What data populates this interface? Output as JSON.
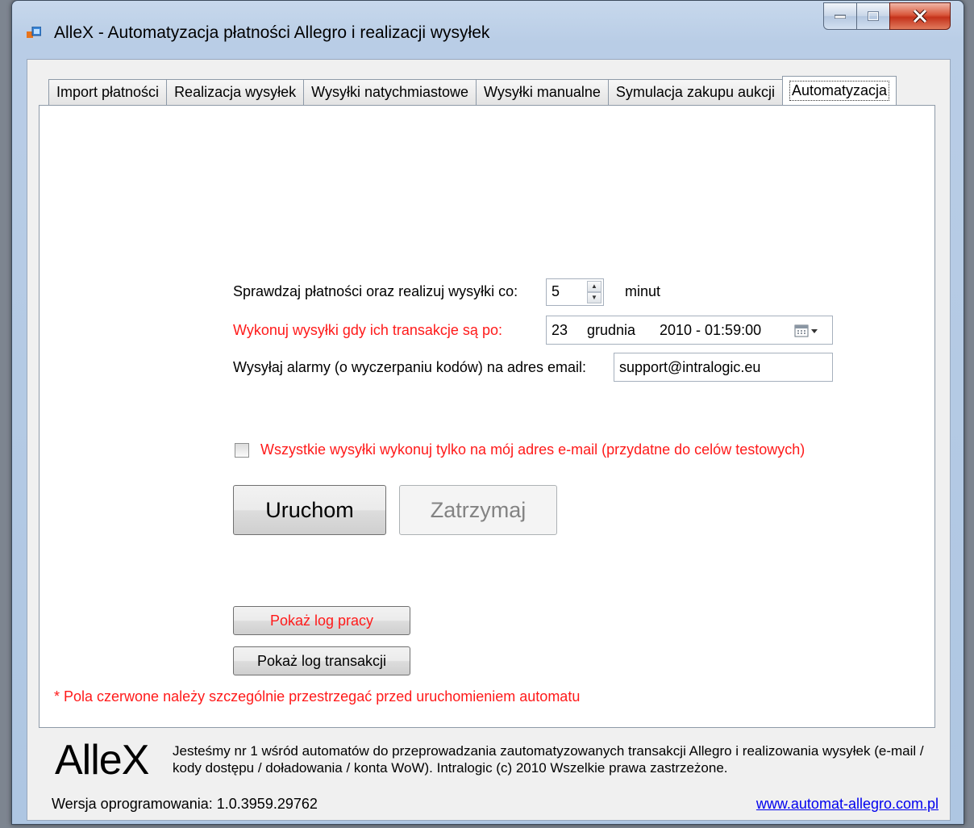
{
  "window": {
    "title": "AlleX - Automatyzacja płatności Allegro i realizacji wysyłek"
  },
  "tabs": [
    {
      "label": "Import płatności"
    },
    {
      "label": "Realizacja wysyłek"
    },
    {
      "label": "Wysyłki natychmiastowe"
    },
    {
      "label": "Wysyłki manualne"
    },
    {
      "label": "Symulacja zakupu aukcji"
    },
    {
      "label": "Automatyzacja",
      "active": true
    }
  ],
  "automation": {
    "interval_label": "Sprawdzaj płatności oraz realizuj wysyłki co:",
    "interval_value": "5",
    "interval_unit": "minut",
    "after_label": "Wykonuj wysyłki gdy ich transakcje są po:",
    "date": {
      "day": "23",
      "month": "grudnia",
      "year_time": "2010 - 01:59:00"
    },
    "email_label": "Wysyłaj alarmy (o wyczerpaniu kodów) na adres email:",
    "email_value": "support@intralogic.eu",
    "test_checkbox_label": "Wszystkie wysyłki wykonuj tylko na mój adres e-mail (przydatne do celów testowych)",
    "test_checkbox_checked": false,
    "start_button": "Uruchom",
    "stop_button": "Zatrzymaj",
    "show_work_log": "Pokaż log pracy",
    "show_transaction_log": "Pokaż log transakcji",
    "note": "* Pola czerwone należy szczególnie przestrzegać przed uruchomieniem automatu"
  },
  "footer": {
    "logo": "AlleX",
    "description": "Jesteśmy nr 1 wśród automatów do przeprowadzania zautomatyzowanych transakcji Allegro i realizowania wysyłek (e-mail / kody dostępu / doładowania / konta WoW).  Intralogic (c) 2010 Wszelkie prawa zastrzeżone.",
    "version": "Wersja oprogramowania: 1.0.3959.29762",
    "link": "www.automat-allegro.com.pl"
  },
  "colors": {
    "required_red": "#ff1a1a",
    "link_blue": "#0000ee"
  },
  "icons": {
    "app": "app-window-icon",
    "calendar": "calendar-dropdown-icon"
  }
}
